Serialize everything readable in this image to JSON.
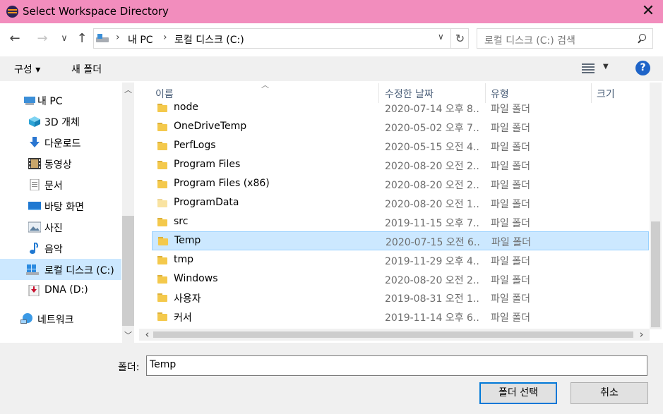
{
  "window": {
    "title": "Select Workspace Directory",
    "app_icon": "eclipse-icon"
  },
  "address": {
    "back_icon": "←",
    "forward_icon": "→",
    "recent_icon": "∨",
    "up_icon": "↑",
    "crumbs": [
      "내 PC",
      "로컬 디스크 (C:)"
    ],
    "search_placeholder": "로컬 디스크 (C:) 검색"
  },
  "toolbar": {
    "organize": "구성 ▾",
    "new_folder": "새 폴더",
    "help": "?"
  },
  "sidebar": {
    "items": [
      {
        "label": "내 PC",
        "icon": "pc-icon"
      },
      {
        "label": "3D 개체",
        "icon": "3d-objects-icon"
      },
      {
        "label": "다운로드",
        "icon": "download-icon"
      },
      {
        "label": "동영상",
        "icon": "video-icon"
      },
      {
        "label": "문서",
        "icon": "document-icon"
      },
      {
        "label": "바탕 화면",
        "icon": "desktop-icon"
      },
      {
        "label": "사진",
        "icon": "picture-icon"
      },
      {
        "label": "음악",
        "icon": "music-icon"
      },
      {
        "label": "로컬 디스크 (C:)",
        "icon": "local-disk-icon"
      },
      {
        "label": "DNA (D:)",
        "icon": "drive-icon"
      },
      {
        "label": "네트워크",
        "icon": "network-icon"
      }
    ]
  },
  "files": {
    "columns": {
      "name": "이름",
      "date": "수정한 날짜",
      "type": "유형",
      "size": "크기"
    },
    "rows": [
      {
        "name": "node",
        "date": "2020-07-14 오후 8...",
        "type": "파일 폴더"
      },
      {
        "name": "OneDriveTemp",
        "date": "2020-05-02 오후 7...",
        "type": "파일 폴더"
      },
      {
        "name": "PerfLogs",
        "date": "2020-05-15 오전 4...",
        "type": "파일 폴더"
      },
      {
        "name": "Program Files",
        "date": "2020-08-20 오전 2...",
        "type": "파일 폴더"
      },
      {
        "name": "Program Files (x86)",
        "date": "2020-08-20 오전 2...",
        "type": "파일 폴더"
      },
      {
        "name": "ProgramData",
        "date": "2020-08-20 오전 1...",
        "type": "파일 폴더"
      },
      {
        "name": "src",
        "date": "2019-11-15 오후 7...",
        "type": "파일 폴더"
      },
      {
        "name": "Temp",
        "date": "2020-07-15 오전 6...",
        "type": "파일 폴더"
      },
      {
        "name": "tmp",
        "date": "2019-11-29 오후 4...",
        "type": "파일 폴더"
      },
      {
        "name": "Windows",
        "date": "2020-08-20 오전 2...",
        "type": "파일 폴더"
      },
      {
        "name": "사용자",
        "date": "2019-08-31 오전 1...",
        "type": "파일 폴더"
      },
      {
        "name": "커서",
        "date": "2019-11-14 오후 6...",
        "type": "파일 폴더"
      }
    ]
  },
  "footer": {
    "folder_label": "폴더:",
    "folder_value": "Temp",
    "select_button": "폴더 선택",
    "cancel_button": "취소"
  },
  "colors": {
    "titlebar": "#f28dbd",
    "selection": "#cce8ff",
    "accent": "#0078d7"
  }
}
